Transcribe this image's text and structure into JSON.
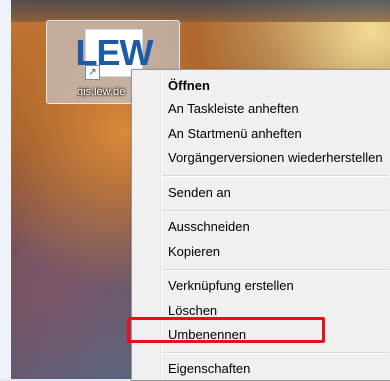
{
  "desktop": {
    "shortcut": {
      "logo_text": "LEW",
      "label": "gis.lew.de",
      "arrow_glyph": "↗"
    }
  },
  "context_menu": {
    "items": [
      {
        "label": "Öffnen"
      },
      {
        "label": "An Taskleiste anheften"
      },
      {
        "label": "An Startmenü anheften"
      },
      {
        "label": "Vorgängerversionen wiederherstellen"
      },
      {
        "label": "Senden an"
      },
      {
        "label": "Ausschneiden"
      },
      {
        "label": "Kopieren"
      },
      {
        "label": "Verknüpfung erstellen"
      },
      {
        "label": "Löschen"
      },
      {
        "label": "Umbenennen"
      },
      {
        "label": "Eigenschaften"
      }
    ]
  },
  "annotation": {
    "color": "#e8101a",
    "target": "Umbenennen"
  }
}
